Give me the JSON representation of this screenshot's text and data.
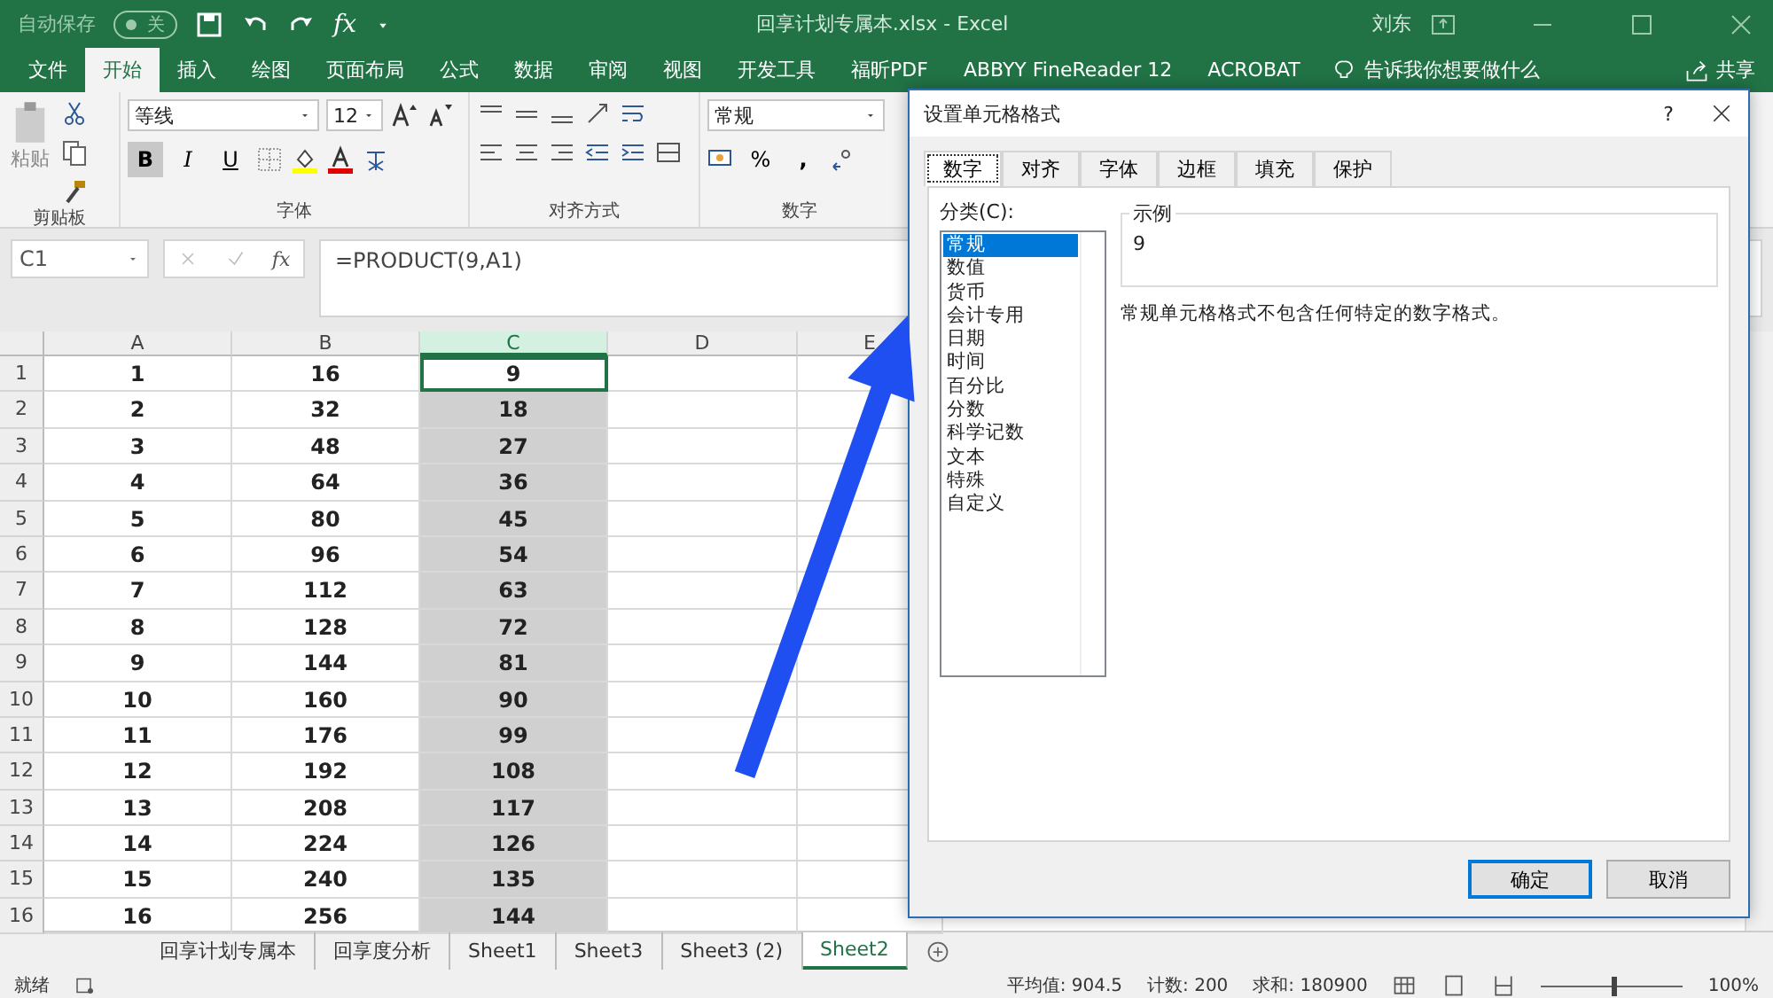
{
  "title_bar": {
    "autosave_label": "自动保存",
    "autosave_on": false,
    "autosave_state": "关",
    "fx_label": "fx",
    "title": "回享计划专属本.xlsx  -  Excel",
    "user": "刘东"
  },
  "ribbon_tabs": [
    {
      "label": "文件",
      "selected": false
    },
    {
      "label": "开始",
      "selected": true
    },
    {
      "label": "插入",
      "selected": false
    },
    {
      "label": "绘图",
      "selected": false
    },
    {
      "label": "页面布局",
      "selected": false
    },
    {
      "label": "公式",
      "selected": false
    },
    {
      "label": "数据",
      "selected": false
    },
    {
      "label": "审阅",
      "selected": false
    },
    {
      "label": "视图",
      "selected": false
    },
    {
      "label": "开发工具",
      "selected": false
    },
    {
      "label": "福昕PDF",
      "selected": false
    },
    {
      "label": "ABBYY FineReader 12",
      "selected": false
    },
    {
      "label": "ACROBAT",
      "selected": false
    }
  ],
  "tell_me": "告诉我你想要做什么",
  "share": "共享",
  "ribbon": {
    "paste_label": "粘贴",
    "font_name": "等线",
    "font_size": "12",
    "bold": "B",
    "italic": "I",
    "underline": "U",
    "number_format": "常规",
    "percent": "%",
    "comma": ",",
    "groups": [
      "剪贴板",
      "字体",
      "对齐方式",
      "数字"
    ]
  },
  "formula_bar": {
    "name_box": "C1",
    "fx_label": "fx",
    "formula": "=PRODUCT(9,A1)"
  },
  "columns": [
    {
      "label": "A",
      "selected": false
    },
    {
      "label": "B",
      "selected": false
    },
    {
      "label": "C",
      "selected": true
    },
    {
      "label": "D",
      "selected": false
    },
    {
      "label": "E",
      "selected": false
    }
  ],
  "rows": [
    {
      "header": "1",
      "cells": [
        "1",
        "16",
        "9"
      ],
      "selected": false
    },
    {
      "header": "2",
      "cells": [
        "2",
        "32",
        "18"
      ],
      "selected": true
    },
    {
      "header": "3",
      "cells": [
        "3",
        "48",
        "27"
      ],
      "selected": true
    },
    {
      "header": "4",
      "cells": [
        "4",
        "64",
        "36"
      ],
      "selected": true
    },
    {
      "header": "5",
      "cells": [
        "5",
        "80",
        "45"
      ],
      "selected": true
    },
    {
      "header": "6",
      "cells": [
        "6",
        "96",
        "54"
      ],
      "selected": true
    },
    {
      "header": "7",
      "cells": [
        "7",
        "112",
        "63"
      ],
      "selected": true
    },
    {
      "header": "8",
      "cells": [
        "8",
        "128",
        "72"
      ],
      "selected": true
    },
    {
      "header": "9",
      "cells": [
        "9",
        "144",
        "81"
      ],
      "selected": true
    },
    {
      "header": "10",
      "cells": [
        "10",
        "160",
        "90"
      ],
      "selected": true
    },
    {
      "header": "11",
      "cells": [
        "11",
        "176",
        "99"
      ],
      "selected": true
    },
    {
      "header": "12",
      "cells": [
        "12",
        "192",
        "108"
      ],
      "selected": true
    },
    {
      "header": "13",
      "cells": [
        "13",
        "208",
        "117"
      ],
      "selected": true
    },
    {
      "header": "14",
      "cells": [
        "14",
        "224",
        "126"
      ],
      "selected": true
    },
    {
      "header": "15",
      "cells": [
        "15",
        "240",
        "135"
      ],
      "selected": true
    },
    {
      "header": "16",
      "cells": [
        "16",
        "256",
        "144"
      ],
      "selected": true
    }
  ],
  "sheet_tabs": [
    {
      "label": "回享计划专属本",
      "selected": false
    },
    {
      "label": "回享度分析",
      "selected": false
    },
    {
      "label": "Sheet1",
      "selected": false
    },
    {
      "label": "Sheet3",
      "selected": false
    },
    {
      "label": "Sheet3 (2)",
      "selected": false
    },
    {
      "label": "Sheet2",
      "selected": true
    }
  ],
  "status_bar": {
    "ready": "就绪",
    "average": "平均值: 904.5",
    "count": "计数: 200",
    "sum": "求和: 180900",
    "zoom": "100%",
    "zoom_slider": {
      "level": 0.5
    }
  },
  "dialog": {
    "title": "设置单元格格式",
    "help": "?",
    "tabs": [
      {
        "label": "数字",
        "selected": true
      },
      {
        "label": "对齐",
        "selected": false
      },
      {
        "label": "字体",
        "selected": false
      },
      {
        "label": "边框",
        "selected": false
      },
      {
        "label": "填充",
        "selected": false
      },
      {
        "label": "保护",
        "selected": false
      }
    ],
    "category_label": "分类(C):",
    "categories": [
      {
        "label": "常规",
        "selected": true
      },
      {
        "label": "数值",
        "selected": false
      },
      {
        "label": "货币",
        "selected": false
      },
      {
        "label": "会计专用",
        "selected": false
      },
      {
        "label": "日期",
        "selected": false
      },
      {
        "label": "时间",
        "selected": false
      },
      {
        "label": "百分比",
        "selected": false
      },
      {
        "label": "分数",
        "selected": false
      },
      {
        "label": "科学记数",
        "selected": false
      },
      {
        "label": "文本",
        "selected": false
      },
      {
        "label": "特殊",
        "selected": false
      },
      {
        "label": "自定义",
        "selected": false
      }
    ],
    "sample_label": "示例",
    "sample_value": "9",
    "description": "常规单元格格式不包含任何特定的数字格式。",
    "buttons": [
      {
        "label": "确定",
        "default": true
      },
      {
        "label": "取消",
        "default": false
      }
    ]
  }
}
